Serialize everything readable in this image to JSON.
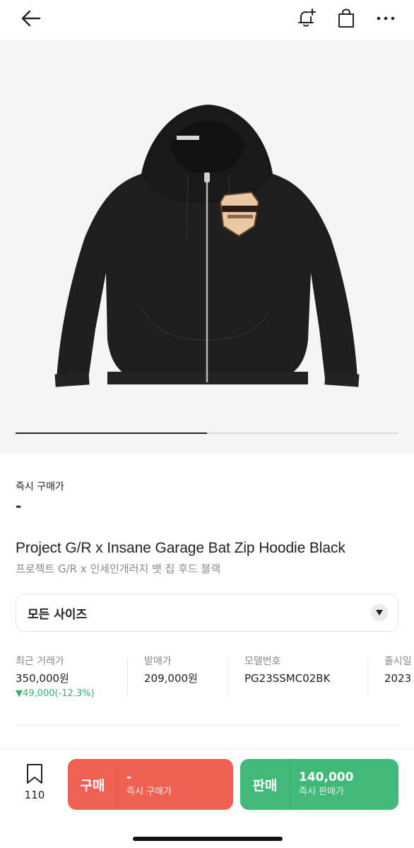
{
  "nav": {
    "back_icon": "arrow-left-icon",
    "alert_icon": "bell-plus-icon",
    "cart_icon": "shopping-bag-icon",
    "more_icon": "more-horizontal-icon"
  },
  "gallery": {
    "progress": 0.5,
    "image_subject": "black zip hoodie"
  },
  "instant_buy": {
    "label": "즉시 구매가",
    "price": "-"
  },
  "product": {
    "title_en": "Project G/R x Insane Garage Bat Zip Hoodie Black",
    "title_ko": "프로젝트 G/R x 인세인개러지 뱃 집 후드 블랙"
  },
  "size_select": {
    "value": "모든 사이즈"
  },
  "stats": [
    {
      "label": "최근 거래가",
      "value": "350,000원",
      "change": "▼49,000(-12.3%)"
    },
    {
      "label": "발매가",
      "value": "209,000원"
    },
    {
      "label": "모델번호",
      "value": "PG23SSMC02BK"
    },
    {
      "label": "출시일",
      "value": "2023"
    }
  ],
  "bottom_bar": {
    "bookmark_count": "110",
    "buy": {
      "label": "구매",
      "price": "-",
      "sub": "즉시 구매가"
    },
    "sell": {
      "label": "판매",
      "price": "140,000",
      "sub": "즉시 판매가"
    }
  },
  "colors": {
    "buy": "#ef6253",
    "sell": "#41b979",
    "price_down": "#31b46e"
  }
}
